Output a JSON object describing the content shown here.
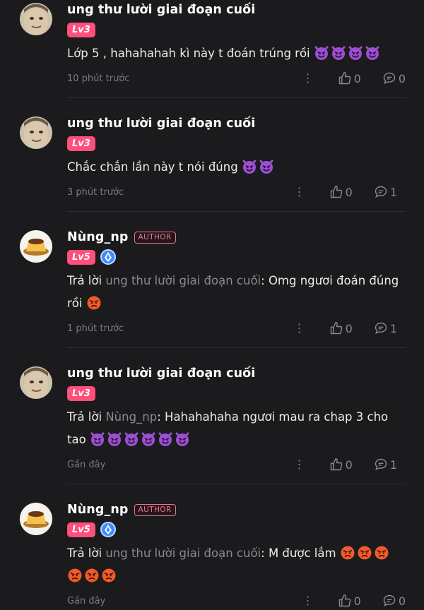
{
  "comments": [
    {
      "name": "ung thư lười giai đoạn cuối",
      "level": "Lv3",
      "is_author": false,
      "text": "Lớp 5 , hahahahah kì này t đoán trúng rồi",
      "emojis": [
        "devil",
        "devil",
        "devil",
        "devil"
      ],
      "time": "10 phút trước",
      "likes": "0",
      "replies": "0"
    },
    {
      "name": "ung thư lười giai đoạn cuối",
      "level": "Lv3",
      "is_author": false,
      "text": "Chắc chắn lần này t nói đúng",
      "emojis": [
        "devil",
        "devil"
      ],
      "time": "3 phút trước",
      "likes": "0",
      "replies": "1"
    },
    {
      "name": "Nùng_np",
      "author_label": "AUTHOR",
      "level": "Lv5",
      "is_author": true,
      "reply_prefix": "Trả lời",
      "reply_to": "ung thư lười giai đoạn cuối",
      "text": ": Omg ngươi đoán đúng rồi",
      "emojis": [
        "angry"
      ],
      "time": "1 phút trước",
      "likes": "0",
      "replies": "1"
    },
    {
      "name": "ung thư lười giai đoạn cuối",
      "level": "Lv3",
      "is_author": false,
      "reply_prefix": "Trả lời",
      "reply_to": "Nùng_np",
      "text": ": Hahahahaha ngươi mau ra chap 3 cho tao",
      "emojis": [
        "devil",
        "devil",
        "devil",
        "devil",
        "devil",
        "devil"
      ],
      "time": "Gần đây",
      "likes": "0",
      "replies": "1"
    },
    {
      "name": "Nùng_np",
      "author_label": "AUTHOR",
      "level": "Lv5",
      "is_author": true,
      "reply_prefix": "Trả lời",
      "reply_to": "ung thư lười giai đoạn cuối",
      "text": ": M được lắm",
      "emojis": [
        "angry",
        "angry",
        "angry",
        "angry",
        "angry",
        "angry"
      ],
      "time": "Gần đây",
      "likes": "0",
      "replies": "0"
    }
  ],
  "icons": {
    "more": "more-vertical-icon",
    "like": "thumbs-up-icon",
    "reply": "comment-bubble-icon",
    "devil": "smiling-devil-emoji",
    "angry": "angry-face-emoji",
    "medal": "level-medal-icon"
  },
  "colors": {
    "background": "#1b1b1d",
    "level_badge": "#ff4f7b",
    "author_tag": "#ff6b8a",
    "muted": "#8a8a8f"
  }
}
